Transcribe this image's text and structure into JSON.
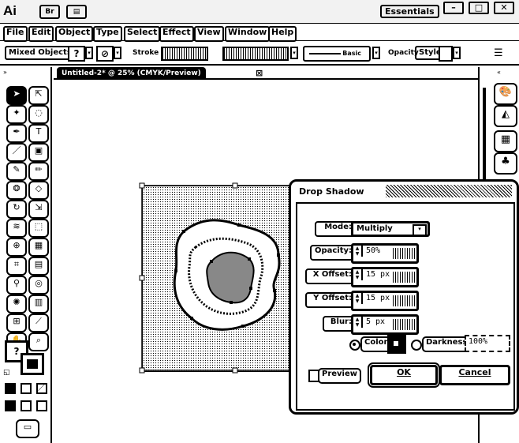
{
  "app": {
    "logo": "Ai",
    "bridge_label": "Br",
    "arrange_label": "▤",
    "workspace": "Essentials",
    "win_min": "–",
    "win_max": "□",
    "win_close": "✕"
  },
  "menu": [
    "File",
    "Edit",
    "Object",
    "Type",
    "Select",
    "Effect",
    "View",
    "Window",
    "Help"
  ],
  "control": {
    "selection": "Mixed Objects",
    "stroke_label": "Stroke",
    "brush": "Basic",
    "opacity_label": "Opacity",
    "style_label": "Style"
  },
  "document": {
    "tab": "Untitled-2* @ 25% (CMYK/Preview)",
    "close": "⊠"
  },
  "dialog": {
    "title": "Drop Shadow",
    "mode_label": "Mode:",
    "mode_value": "Multiply",
    "opacity_label": "Opacity:",
    "opacity_value": "50%",
    "xoffset_label": "X Offset:",
    "xoffset_value": "15 px",
    "yoffset_label": "Y Offset:",
    "yoffset_value": "15 px",
    "blur_label": "Blur:",
    "blur_value": "5 px",
    "color_label": "Color:",
    "darkness_label": "Darkness:",
    "darkness_value": "100%",
    "color_selected": true,
    "preview_label": "Preview",
    "ok_label": "OK",
    "cancel_label": "Cancel"
  },
  "colors": {
    "chrome": "#f2f2f2",
    "ink": "#000000",
    "paper": "#ffffff"
  }
}
